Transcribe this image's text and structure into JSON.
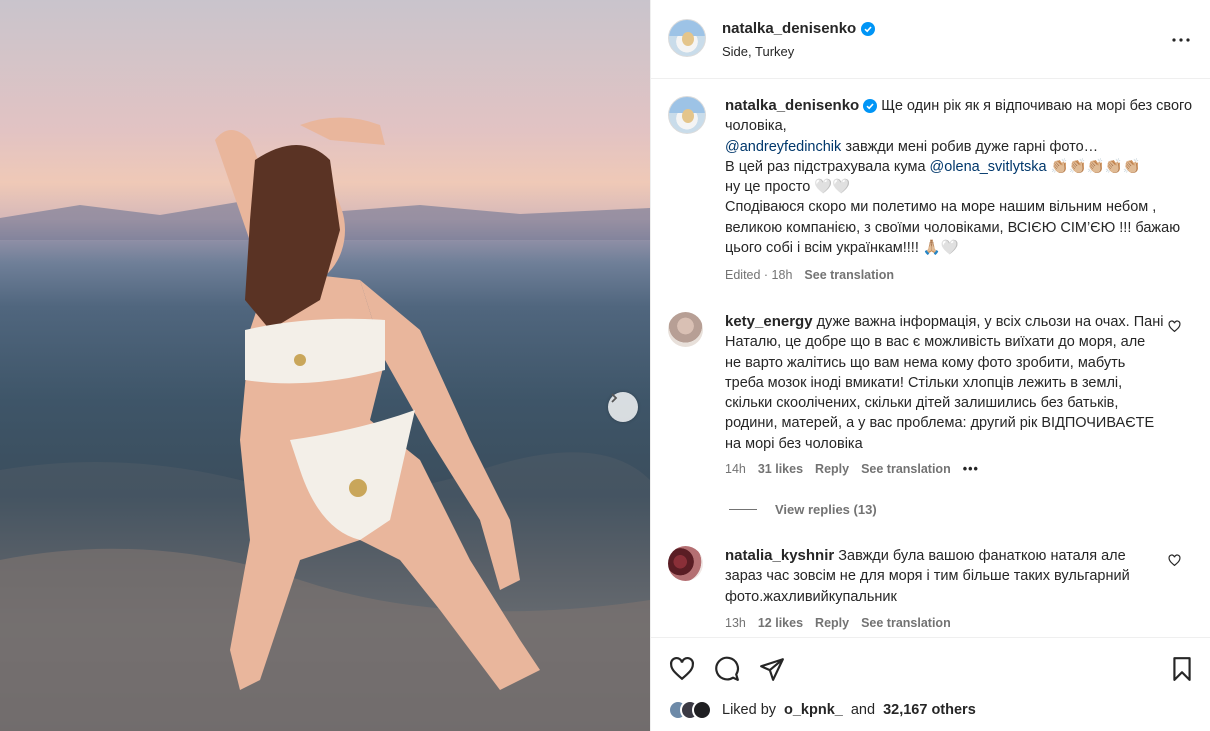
{
  "post": {
    "username": "natalka_denisenko",
    "location": "Side, Turkey"
  },
  "caption": {
    "username": "natalka_denisenko",
    "line1": "Ще один рік як я відпочиваю на морі без свого чоловіка,",
    "mention1": "@andreyfedinchik",
    "line2": " завжди мені робив дуже гарні фото…",
    "line3_pre": "В цей раз підстрахувала кума ",
    "mention2": "@olena_svitlytska",
    "line3_emoji": " 👏🏼👏🏼👏🏼👏🏼👏🏼",
    "line4": "ну це просто 🤍🤍",
    "line5": "Сподіваюся скоро ми полетимо на море нашим вільним небом , великою компанією, з своїми чоловіками, ВСІЄЮ СІМ’ЄЮ !!! бажаю цього собі і всім українкам!!!! 🙏🏼🤍",
    "edited": "Edited · 18h",
    "see_translation": "See translation"
  },
  "comments": [
    {
      "username": "kety_energy",
      "text": "дуже важна інформація, у всіх сльози на очах. Пані Наталю, це добре що в вас є можливість виїхати до моря, але не варто жалітись що вам нема кому фото зробити, мабуть треба мозок іноді вмикати! Стільки хлопців лежить в землі, скільки скоолічених, скільки дітей залишились без батьків, родини, матерей, а у вас проблема: другий рік ВІДПОЧИВАЄТЕ на морі без чоловіка",
      "time": "14h",
      "likes": "31 likes",
      "reply": "Reply",
      "see_translation": "See translation",
      "more": "•••"
    },
    {
      "username": "natalia_kyshnir",
      "text": "Завжди була вашою фанаткою наталя але зараз час зовсім не для моря і тим більше таких вульгарний фото.жахливийкупальник",
      "time": "13h",
      "likes": "12 likes",
      "reply": "Reply",
      "see_translation": "See translation"
    }
  ],
  "view_replies": "View replies (13)",
  "liked_by": {
    "prefix": "Liked by",
    "user": "o_kpnk_",
    "and": "and",
    "count": "32,167 others"
  },
  "icons": [
    "heart-icon",
    "comment-icon",
    "share-icon",
    "bookmark-icon",
    "more-icon",
    "verified-icon",
    "chevron-right-icon"
  ],
  "colors": {
    "verified": "#0095f6",
    "link": "#00376b",
    "muted": "#737373"
  }
}
